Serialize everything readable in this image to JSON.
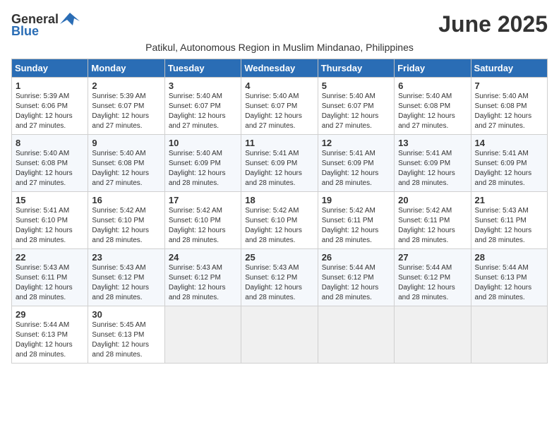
{
  "header": {
    "logo_general": "General",
    "logo_blue": "Blue",
    "month_title": "June 2025",
    "subtitle": "Patikul, Autonomous Region in Muslim Mindanao, Philippines"
  },
  "weekdays": [
    "Sunday",
    "Monday",
    "Tuesday",
    "Wednesday",
    "Thursday",
    "Friday",
    "Saturday"
  ],
  "weeks": [
    [
      {
        "day": "1",
        "sunrise": "Sunrise: 5:39 AM",
        "sunset": "Sunset: 6:06 PM",
        "daylight": "Daylight: 12 hours and 27 minutes."
      },
      {
        "day": "2",
        "sunrise": "Sunrise: 5:39 AM",
        "sunset": "Sunset: 6:07 PM",
        "daylight": "Daylight: 12 hours and 27 minutes."
      },
      {
        "day": "3",
        "sunrise": "Sunrise: 5:40 AM",
        "sunset": "Sunset: 6:07 PM",
        "daylight": "Daylight: 12 hours and 27 minutes."
      },
      {
        "day": "4",
        "sunrise": "Sunrise: 5:40 AM",
        "sunset": "Sunset: 6:07 PM",
        "daylight": "Daylight: 12 hours and 27 minutes."
      },
      {
        "day": "5",
        "sunrise": "Sunrise: 5:40 AM",
        "sunset": "Sunset: 6:07 PM",
        "daylight": "Daylight: 12 hours and 27 minutes."
      },
      {
        "day": "6",
        "sunrise": "Sunrise: 5:40 AM",
        "sunset": "Sunset: 6:08 PM",
        "daylight": "Daylight: 12 hours and 27 minutes."
      },
      {
        "day": "7",
        "sunrise": "Sunrise: 5:40 AM",
        "sunset": "Sunset: 6:08 PM",
        "daylight": "Daylight: 12 hours and 27 minutes."
      }
    ],
    [
      {
        "day": "8",
        "sunrise": "Sunrise: 5:40 AM",
        "sunset": "Sunset: 6:08 PM",
        "daylight": "Daylight: 12 hours and 27 minutes."
      },
      {
        "day": "9",
        "sunrise": "Sunrise: 5:40 AM",
        "sunset": "Sunset: 6:08 PM",
        "daylight": "Daylight: 12 hours and 27 minutes."
      },
      {
        "day": "10",
        "sunrise": "Sunrise: 5:40 AM",
        "sunset": "Sunset: 6:09 PM",
        "daylight": "Daylight: 12 hours and 28 minutes."
      },
      {
        "day": "11",
        "sunrise": "Sunrise: 5:41 AM",
        "sunset": "Sunset: 6:09 PM",
        "daylight": "Daylight: 12 hours and 28 minutes."
      },
      {
        "day": "12",
        "sunrise": "Sunrise: 5:41 AM",
        "sunset": "Sunset: 6:09 PM",
        "daylight": "Daylight: 12 hours and 28 minutes."
      },
      {
        "day": "13",
        "sunrise": "Sunrise: 5:41 AM",
        "sunset": "Sunset: 6:09 PM",
        "daylight": "Daylight: 12 hours and 28 minutes."
      },
      {
        "day": "14",
        "sunrise": "Sunrise: 5:41 AM",
        "sunset": "Sunset: 6:09 PM",
        "daylight": "Daylight: 12 hours and 28 minutes."
      }
    ],
    [
      {
        "day": "15",
        "sunrise": "Sunrise: 5:41 AM",
        "sunset": "Sunset: 6:10 PM",
        "daylight": "Daylight: 12 hours and 28 minutes."
      },
      {
        "day": "16",
        "sunrise": "Sunrise: 5:42 AM",
        "sunset": "Sunset: 6:10 PM",
        "daylight": "Daylight: 12 hours and 28 minutes."
      },
      {
        "day": "17",
        "sunrise": "Sunrise: 5:42 AM",
        "sunset": "Sunset: 6:10 PM",
        "daylight": "Daylight: 12 hours and 28 minutes."
      },
      {
        "day": "18",
        "sunrise": "Sunrise: 5:42 AM",
        "sunset": "Sunset: 6:10 PM",
        "daylight": "Daylight: 12 hours and 28 minutes."
      },
      {
        "day": "19",
        "sunrise": "Sunrise: 5:42 AM",
        "sunset": "Sunset: 6:11 PM",
        "daylight": "Daylight: 12 hours and 28 minutes."
      },
      {
        "day": "20",
        "sunrise": "Sunrise: 5:42 AM",
        "sunset": "Sunset: 6:11 PM",
        "daylight": "Daylight: 12 hours and 28 minutes."
      },
      {
        "day": "21",
        "sunrise": "Sunrise: 5:43 AM",
        "sunset": "Sunset: 6:11 PM",
        "daylight": "Daylight: 12 hours and 28 minutes."
      }
    ],
    [
      {
        "day": "22",
        "sunrise": "Sunrise: 5:43 AM",
        "sunset": "Sunset: 6:11 PM",
        "daylight": "Daylight: 12 hours and 28 minutes."
      },
      {
        "day": "23",
        "sunrise": "Sunrise: 5:43 AM",
        "sunset": "Sunset: 6:12 PM",
        "daylight": "Daylight: 12 hours and 28 minutes."
      },
      {
        "day": "24",
        "sunrise": "Sunrise: 5:43 AM",
        "sunset": "Sunset: 6:12 PM",
        "daylight": "Daylight: 12 hours and 28 minutes."
      },
      {
        "day": "25",
        "sunrise": "Sunrise: 5:43 AM",
        "sunset": "Sunset: 6:12 PM",
        "daylight": "Daylight: 12 hours and 28 minutes."
      },
      {
        "day": "26",
        "sunrise": "Sunrise: 5:44 AM",
        "sunset": "Sunset: 6:12 PM",
        "daylight": "Daylight: 12 hours and 28 minutes."
      },
      {
        "day": "27",
        "sunrise": "Sunrise: 5:44 AM",
        "sunset": "Sunset: 6:12 PM",
        "daylight": "Daylight: 12 hours and 28 minutes."
      },
      {
        "day": "28",
        "sunrise": "Sunrise: 5:44 AM",
        "sunset": "Sunset: 6:13 PM",
        "daylight": "Daylight: 12 hours and 28 minutes."
      }
    ],
    [
      {
        "day": "29",
        "sunrise": "Sunrise: 5:44 AM",
        "sunset": "Sunset: 6:13 PM",
        "daylight": "Daylight: 12 hours and 28 minutes."
      },
      {
        "day": "30",
        "sunrise": "Sunrise: 5:45 AM",
        "sunset": "Sunset: 6:13 PM",
        "daylight": "Daylight: 12 hours and 28 minutes."
      },
      null,
      null,
      null,
      null,
      null
    ]
  ]
}
